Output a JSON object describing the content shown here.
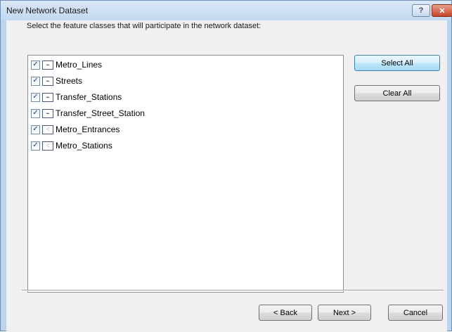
{
  "window": {
    "title": "New Network Dataset",
    "help_glyph": "?",
    "close_glyph": "✕"
  },
  "instruction": "Select the feature classes that will participate in the network dataset:",
  "feature_classes": [
    {
      "label": "Metro_Lines",
      "checked": true,
      "icon": "line-feature-icon",
      "glyph": "⌁"
    },
    {
      "label": "Streets",
      "checked": true,
      "icon": "line-feature-icon",
      "glyph": "⌁"
    },
    {
      "label": "Transfer_Stations",
      "checked": true,
      "icon": "line-feature-icon",
      "glyph": "⌁"
    },
    {
      "label": "Transfer_Street_Station",
      "checked": true,
      "icon": "line-feature-icon",
      "glyph": "⌁"
    },
    {
      "label": "Metro_Entrances",
      "checked": true,
      "icon": "point-feature-icon",
      "glyph": "⁖"
    },
    {
      "label": "Metro_Stations",
      "checked": true,
      "icon": "point-feature-icon",
      "glyph": "⁖"
    }
  ],
  "check_glyph": "✓",
  "buttons": {
    "select_all": "Select All",
    "clear_all": "Clear All",
    "back": "< Back",
    "next": "Next >",
    "cancel": "Cancel"
  }
}
